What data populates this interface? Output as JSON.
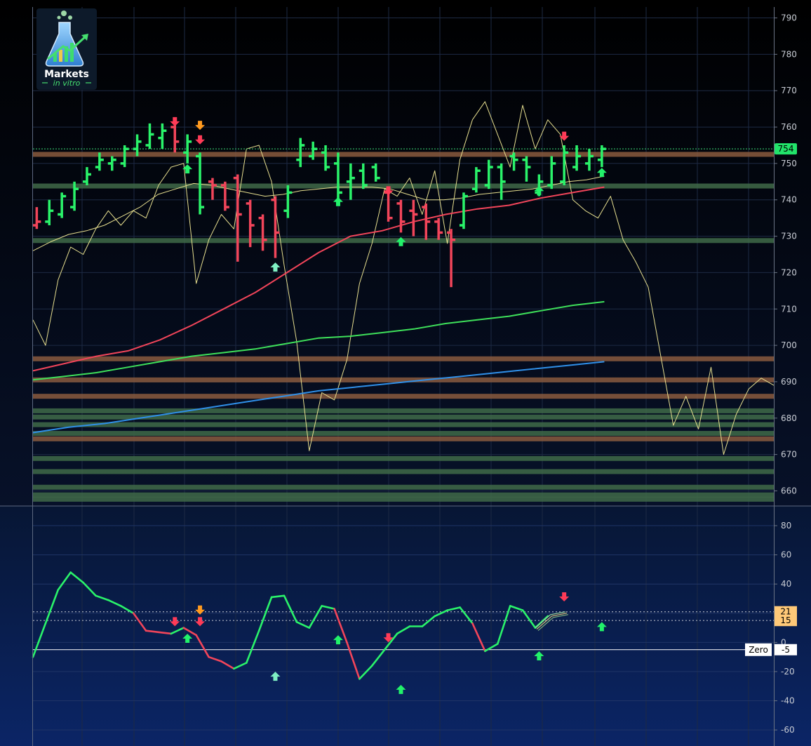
{
  "logo": {
    "title": "Markets",
    "subtitle": "in vitro"
  },
  "colors": {
    "up": "#2af36a",
    "down": "#f2455a",
    "price_line": "#e7df8f",
    "ma_red": "#f2455a",
    "ma_green": "#3ee05a",
    "ma_blue": "#2f8fe8",
    "ma_yellow": "#e7df8f",
    "arrow_orange": "#ff9a1f",
    "arrow_teal": "#7ff0c3",
    "level_orange": "#8a5a3e",
    "level_green": "#3f6a48",
    "zero_line": "#ffffff"
  },
  "chart_data": [
    {
      "type": "line",
      "panel": "price",
      "ylim": [
        657,
        793
      ],
      "ticks": [
        660,
        670,
        680,
        690,
        700,
        710,
        720,
        730,
        740,
        750,
        760,
        770,
        780,
        790
      ],
      "grid": true,
      "last_price_label": "754",
      "last_price": 754,
      "bars": [
        {
          "x": 0,
          "o": 733,
          "h": 738,
          "l": 732,
          "c": 734,
          "up": false
        },
        {
          "x": 1,
          "o": 734,
          "h": 740,
          "l": 733,
          "c": 737,
          "up": true
        },
        {
          "x": 2,
          "o": 736,
          "h": 742,
          "l": 735,
          "c": 741,
          "up": true
        },
        {
          "x": 3,
          "o": 738,
          "h": 745,
          "l": 737,
          "c": 743,
          "up": true
        },
        {
          "x": 4,
          "o": 745,
          "h": 749,
          "l": 744,
          "c": 747,
          "up": true
        },
        {
          "x": 5,
          "o": 749,
          "h": 753,
          "l": 748,
          "c": 751,
          "up": true
        },
        {
          "x": 6,
          "o": 750,
          "h": 752,
          "l": 748,
          "c": 751,
          "up": true
        },
        {
          "x": 7,
          "o": 750,
          "h": 755,
          "l": 749,
          "c": 754,
          "up": true
        },
        {
          "x": 8,
          "o": 754,
          "h": 758,
          "l": 752,
          "c": 756,
          "up": true
        },
        {
          "x": 9,
          "o": 755,
          "h": 761,
          "l": 754,
          "c": 758,
          "up": true
        },
        {
          "x": 10,
          "o": 757,
          "h": 761,
          "l": 754,
          "c": 759,
          "up": true
        },
        {
          "x": 11,
          "o": 760,
          "h": 761,
          "l": 753,
          "c": 756,
          "up": false
        },
        {
          "x": 12,
          "o": 753,
          "h": 758,
          "l": 750,
          "c": 756,
          "up": true
        },
        {
          "x": 13,
          "o": 752,
          "h": 753,
          "l": 736,
          "c": 738,
          "up": true
        },
        {
          "x": 14,
          "o": 745,
          "h": 746,
          "l": 740,
          "c": 744,
          "up": false
        },
        {
          "x": 15,
          "o": 744,
          "h": 745,
          "l": 737,
          "c": 738,
          "up": false
        },
        {
          "x": 16,
          "o": 746,
          "h": 747,
          "l": 723,
          "c": 736,
          "up": false
        },
        {
          "x": 17,
          "o": 739,
          "h": 740,
          "l": 727,
          "c": 733,
          "up": false
        },
        {
          "x": 18,
          "o": 735,
          "h": 736,
          "l": 726,
          "c": 729,
          "up": false
        },
        {
          "x": 19,
          "o": 740,
          "h": 741,
          "l": 724,
          "c": 731,
          "up": false
        },
        {
          "x": 20,
          "o": 737,
          "h": 744,
          "l": 735,
          "c": 742,
          "up": true
        },
        {
          "x": 21,
          "o": 751,
          "h": 757,
          "l": 749,
          "c": 755,
          "up": true
        },
        {
          "x": 22,
          "o": 752,
          "h": 756,
          "l": 751,
          "c": 754,
          "up": true
        },
        {
          "x": 23,
          "o": 753,
          "h": 755,
          "l": 748,
          "c": 749,
          "up": true
        },
        {
          "x": 24,
          "o": 750,
          "h": 753,
          "l": 740,
          "c": 742,
          "up": true
        },
        {
          "x": 25,
          "o": 745,
          "h": 750,
          "l": 740,
          "c": 746,
          "up": true
        },
        {
          "x": 26,
          "o": 748,
          "h": 750,
          "l": 743,
          "c": 744,
          "up": true
        },
        {
          "x": 27,
          "o": 749,
          "h": 750,
          "l": 745,
          "c": 746,
          "up": true
        },
        {
          "x": 28,
          "o": 742,
          "h": 743,
          "l": 734,
          "c": 735,
          "up": false
        },
        {
          "x": 29,
          "o": 739,
          "h": 740,
          "l": 731,
          "c": 734,
          "up": false
        },
        {
          "x": 30,
          "o": 737,
          "h": 740,
          "l": 730,
          "c": 736,
          "up": false
        },
        {
          "x": 31,
          "o": 738,
          "h": 739,
          "l": 729,
          "c": 734,
          "up": false
        },
        {
          "x": 32,
          "o": 734,
          "h": 735,
          "l": 729,
          "c": 731,
          "up": false
        },
        {
          "x": 33,
          "o": 731,
          "h": 732,
          "l": 716,
          "c": 729,
          "up": false
        },
        {
          "x": 34,
          "o": 733,
          "h": 742,
          "l": 732,
          "c": 741,
          "up": true
        },
        {
          "x": 35,
          "o": 743,
          "h": 749,
          "l": 742,
          "c": 748,
          "up": true
        },
        {
          "x": 36,
          "o": 744,
          "h": 751,
          "l": 743,
          "c": 749,
          "up": true
        },
        {
          "x": 37,
          "o": 749,
          "h": 750,
          "l": 740,
          "c": 745,
          "up": true
        },
        {
          "x": 38,
          "o": 752,
          "h": 753,
          "l": 748,
          "c": 751,
          "up": true
        },
        {
          "x": 39,
          "o": 751,
          "h": 752,
          "l": 745,
          "c": 749,
          "up": true
        },
        {
          "x": 40,
          "o": 742,
          "h": 747,
          "l": 741,
          "c": 745,
          "up": true
        },
        {
          "x": 41,
          "o": 744,
          "h": 752,
          "l": 743,
          "c": 750,
          "up": true
        },
        {
          "x": 42,
          "o": 745,
          "h": 755,
          "l": 744,
          "c": 753,
          "up": true
        },
        {
          "x": 43,
          "o": 749,
          "h": 755,
          "l": 748,
          "c": 752,
          "up": true
        },
        {
          "x": 44,
          "o": 750,
          "h": 754,
          "l": 748,
          "c": 752,
          "up": true
        },
        {
          "x": 45,
          "o": 751,
          "h": 755,
          "l": 749,
          "c": 754,
          "up": true
        }
      ],
      "series": [
        {
          "id": "price_line",
          "values": [
            707,
            700,
            718,
            727,
            725,
            732,
            737,
            733,
            737,
            735,
            744,
            749,
            750,
            717,
            729,
            736,
            732,
            754,
            755,
            745,
            722,
            701,
            671,
            687,
            685,
            696,
            717,
            728,
            743,
            741,
            746,
            736,
            748,
            728,
            751,
            762,
            767,
            758,
            749,
            766,
            754,
            762,
            758,
            740,
            737,
            735,
            741,
            729,
            723,
            716,
            697,
            678,
            686,
            677,
            694,
            670,
            681,
            688,
            691,
            689
          ]
        },
        {
          "id": "ma_yellow",
          "values": [
            726,
            728.5,
            730.5,
            731.5,
            733,
            735.5,
            738,
            741.5,
            743,
            744.5,
            744,
            743,
            742,
            741,
            741.5,
            742.5,
            743,
            743.5,
            743.5,
            743.5,
            743,
            741.5,
            740,
            740,
            740.5,
            741.5,
            742,
            742.5,
            743,
            744,
            745,
            745.5,
            746.5
          ]
        },
        {
          "id": "ma_red",
          "values": [
            693,
            695,
            697,
            698.5,
            701.5,
            705.5,
            710,
            714.5,
            720,
            725.5,
            730,
            731.5,
            734,
            736,
            737.5,
            738.5,
            740.5,
            742,
            743.5
          ]
        },
        {
          "id": "ma_green",
          "values": [
            690.5,
            691.5,
            692.5,
            694,
            695.5,
            697,
            698,
            699,
            700.5,
            702,
            702.5,
            703.5,
            704.5,
            706,
            707,
            708,
            709.5,
            711,
            712
          ]
        },
        {
          "id": "ma_blue",
          "values": [
            676,
            677.5,
            678.5,
            680,
            681.5,
            683,
            684.5,
            686,
            687.5,
            688.5,
            689.5,
            690.5,
            691.5,
            692.5,
            693.5,
            694.5,
            695.5
          ]
        }
      ],
      "levels": [
        {
          "y": 752.5,
          "kind": "orange"
        },
        {
          "y": 743.8,
          "kind": "green"
        },
        {
          "y": 728.8,
          "kind": "green"
        },
        {
          "y": 696.3,
          "kind": "orange"
        },
        {
          "y": 690.5,
          "kind": "orange"
        },
        {
          "y": 686.0,
          "kind": "orange"
        },
        {
          "y": 682.0,
          "kind": "green"
        },
        {
          "y": 680.3,
          "kind": "green"
        },
        {
          "y": 678.2,
          "kind": "green"
        },
        {
          "y": 675.8,
          "kind": "green"
        },
        {
          "y": 674.3,
          "kind": "orange"
        },
        {
          "y": 668.9,
          "kind": "green"
        },
        {
          "y": 665.3,
          "kind": "green"
        },
        {
          "y": 661.0,
          "kind": "green"
        },
        {
          "y": 658.9,
          "kind": "green"
        },
        {
          "y": 657.7,
          "kind": "green"
        }
      ],
      "signals": [
        {
          "x": 11,
          "y": 761,
          "dir": "down",
          "color": "red"
        },
        {
          "x": 12,
          "y": 749,
          "dir": "up",
          "color": "green"
        },
        {
          "x": 13,
          "y": 760,
          "dir": "down",
          "color": "orange"
        },
        {
          "x": 13,
          "y": 756,
          "dir": "down",
          "color": "red"
        },
        {
          "x": 19,
          "y": 722,
          "dir": "up",
          "color": "teal"
        },
        {
          "x": 24,
          "y": 740,
          "dir": "up",
          "color": "green"
        },
        {
          "x": 28,
          "y": 742,
          "dir": "down",
          "color": "red"
        },
        {
          "x": 29,
          "y": 729,
          "dir": "up",
          "color": "green"
        },
        {
          "x": 40,
          "y": 743,
          "dir": "up",
          "color": "green"
        },
        {
          "x": 42,
          "y": 757,
          "dir": "down",
          "color": "red"
        },
        {
          "x": 45,
          "y": 748,
          "dir": "up",
          "color": "green"
        }
      ]
    },
    {
      "type": "line",
      "panel": "oscillator",
      "ylim": [
        -71,
        93
      ],
      "ticks": [
        -60,
        -40,
        -20,
        0,
        20,
        40,
        60,
        80
      ],
      "grid": true,
      "zero_label": "Zero",
      "zero_value_label": "-5",
      "zero_value": -5,
      "level_labels": [
        {
          "label": "21",
          "value": 21
        },
        {
          "label": "15",
          "value": 15
        }
      ],
      "series": [
        {
          "id": "oscillator",
          "values": [
            -10,
            13,
            36,
            48,
            41,
            32,
            29,
            25,
            20,
            8,
            7,
            6,
            10,
            5,
            -10,
            -13,
            -18,
            -14,
            8,
            31,
            32,
            14,
            10,
            25,
            23,
            0,
            -25,
            -16,
            -5,
            6,
            11,
            11,
            18,
            22,
            24,
            13,
            -6,
            -1,
            25,
            22,
            10,
            18
          ]
        },
        {
          "id": "oscillator_tail",
          "values": [
            10,
            19,
            21
          ]
        }
      ],
      "signals": [
        {
          "x": 11,
          "y": 13,
          "dir": "down",
          "color": "red"
        },
        {
          "x": 12,
          "y": 4,
          "dir": "up",
          "color": "green"
        },
        {
          "x": 13,
          "y": 21,
          "dir": "down",
          "color": "orange"
        },
        {
          "x": 13,
          "y": 13,
          "dir": "down",
          "color": "red"
        },
        {
          "x": 19,
          "y": -22,
          "dir": "up",
          "color": "teal"
        },
        {
          "x": 24,
          "y": 3,
          "dir": "up",
          "color": "green"
        },
        {
          "x": 28,
          "y": 2,
          "dir": "down",
          "color": "red"
        },
        {
          "x": 29,
          "y": -31,
          "dir": "up",
          "color": "green"
        },
        {
          "x": 40,
          "y": -8,
          "dir": "up",
          "color": "green"
        },
        {
          "x": 42,
          "y": 30,
          "dir": "down",
          "color": "red"
        },
        {
          "x": 45,
          "y": 12,
          "dir": "up",
          "color": "green"
        }
      ]
    }
  ]
}
